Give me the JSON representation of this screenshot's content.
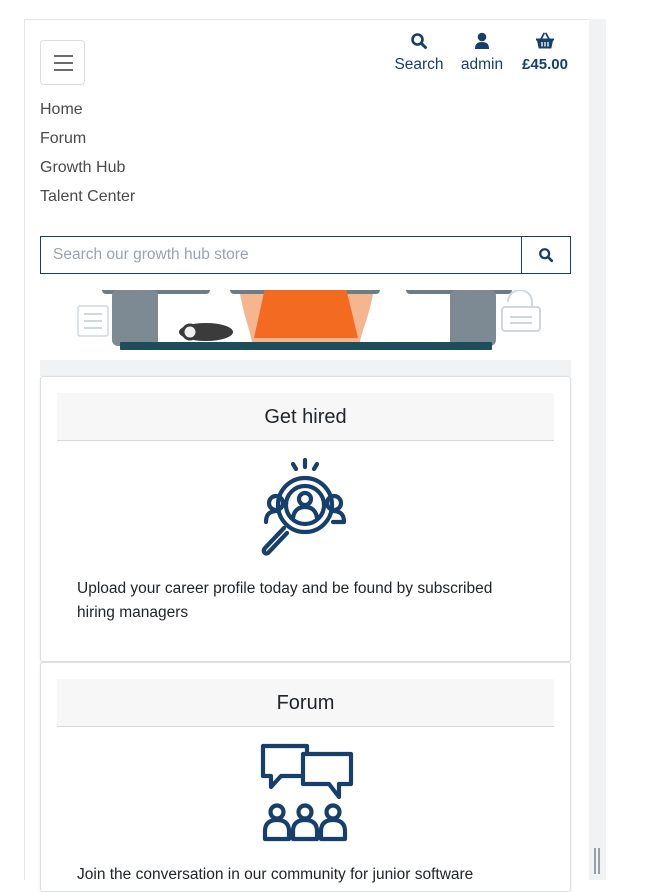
{
  "header": {
    "menu_icon": "hamburger-icon",
    "links": [
      {
        "label": "Search",
        "icon": "search-icon"
      },
      {
        "label": "admin",
        "icon": "user-icon"
      },
      {
        "label": "£45.00",
        "icon": "basket-icon"
      }
    ]
  },
  "nav": {
    "items": [
      {
        "label": "Home"
      },
      {
        "label": "Forum"
      },
      {
        "label": "Growth Hub"
      },
      {
        "label": "Talent Center"
      }
    ]
  },
  "search": {
    "placeholder": "Search our growth hub store",
    "value": "",
    "button_icon": "search-icon"
  },
  "cards": [
    {
      "title": "Get hired",
      "icon": "recruitment-magnifier-icon",
      "text": "Upload your career profile today and be found by subscribed hiring managers"
    },
    {
      "title": "Forum",
      "icon": "community-chat-icon",
      "text": "Join the conversation in our community for junior software"
    }
  ],
  "colors": {
    "brand": "#173f6b",
    "hero_accent": "#f26b21",
    "page_bg": "#ffffff",
    "gutter": "#f1f2f4"
  }
}
